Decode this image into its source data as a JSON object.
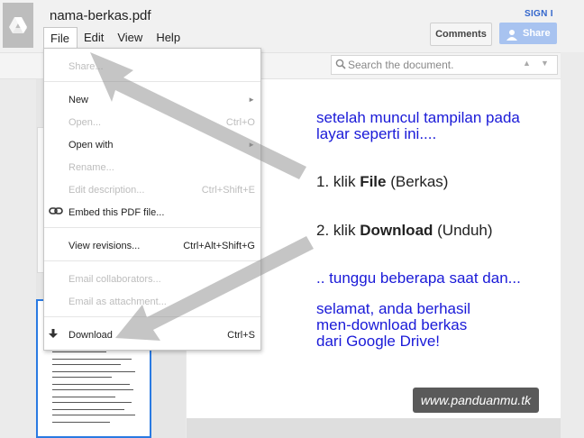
{
  "doc": {
    "title": "nama-berkas.pdf"
  },
  "menubar": {
    "file": "File",
    "edit": "Edit",
    "view": "View",
    "help": "Help"
  },
  "header": {
    "signin": "SIGN I",
    "comments": "Comments",
    "share": "Share"
  },
  "search": {
    "placeholder": "Search the document.",
    "prev": "▲",
    "next": "▼"
  },
  "file_menu": [
    {
      "label": "Share...",
      "enabled": false
    },
    {
      "label": "New",
      "submenu": true,
      "enabled": true
    },
    {
      "label": "Open...",
      "shortcut": "Ctrl+O",
      "enabled": false
    },
    {
      "label": "Open with",
      "submenu": true,
      "enabled": true
    },
    {
      "label": "Rename...",
      "enabled": false
    },
    {
      "label": "Edit description...",
      "shortcut": "Ctrl+Shift+E",
      "enabled": false
    },
    {
      "label": "Embed this PDF file...",
      "icon": "link-icon",
      "enabled": true
    },
    {
      "label": "View revisions...",
      "shortcut": "Ctrl+Alt+Shift+G",
      "enabled": true
    },
    {
      "label": "Email collaborators...",
      "enabled": false
    },
    {
      "label": "Email as attachment...",
      "enabled": false
    },
    {
      "label": "Download",
      "shortcut": "Ctrl+S",
      "icon": "download-icon",
      "enabled": true
    }
  ],
  "submenu_arrow": "►",
  "content": {
    "intro_line1": "setelah muncul tampilan pada",
    "intro_line2": "layar seperti ini....",
    "step1_prefix": "1. klik ",
    "step1_bold": "File",
    "step1_suffix": " (Berkas)",
    "step2_prefix": "2. klik ",
    "step2_bold": "Download",
    "step2_suffix": " (Unduh)",
    "wait": ".. tunggu beberapa saat dan...",
    "done_line1": "selamat, anda berhasil",
    "done_line2": "men-download berkas",
    "done_line3": "dari Google Drive!",
    "watermark": "www.panduanmu.tk"
  },
  "colors": {
    "caption": "#1a1ad8",
    "accent": "#2a7ae2",
    "share_button": "#a8c3f0"
  }
}
